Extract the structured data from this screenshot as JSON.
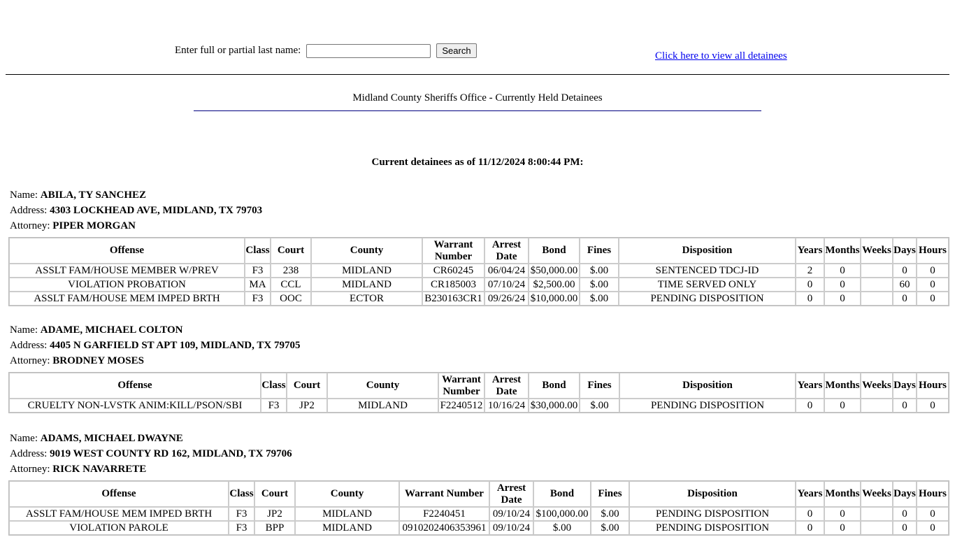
{
  "search": {
    "label": "Enter full or partial last name:",
    "value": "",
    "button": "Search"
  },
  "all_link": "Click here to view all detainees",
  "title": "Midland County Sheriffs Office - Currently Held Detainees",
  "as_of": "Current detainees as of 11/12/2024 8:00:44 PM:",
  "labels": {
    "name": "Name:",
    "address": "Address:",
    "attorney": "Attorney:"
  },
  "columns": [
    "Offense",
    "Class",
    "Court",
    "County",
    "Warrant Number",
    "Arrest Date",
    "Bond",
    "Fines",
    "Disposition",
    "Years",
    "Months",
    "Weeks",
    "Days",
    "Hours"
  ],
  "detainees": [
    {
      "name": "ABILA, TY SANCHEZ",
      "address": "4303 LOCKHEAD AVE, MIDLAND, TX 79703",
      "attorney": "PIPER MORGAN",
      "rows": [
        [
          "ASSLT FAM/HOUSE MEMBER W/PREV",
          "F3",
          "238",
          "MIDLAND",
          "CR60245",
          "06/04/24",
          "$50,000.00",
          "$.00",
          "SENTENCED TDCJ-ID",
          "2",
          "0",
          "",
          "0",
          "0"
        ],
        [
          "VIOLATION PROBATION",
          "MA",
          "CCL",
          "MIDLAND",
          "CR185003",
          "07/10/24",
          "$2,500.00",
          "$.00",
          "TIME SERVED ONLY",
          "0",
          "0",
          "",
          "60",
          "0"
        ],
        [
          "ASSLT FAM/HOUSE MEM IMPED BRTH",
          "F3",
          "OOC",
          "ECTOR",
          "B230163CR1",
          "09/26/24",
          "$10,000.00",
          "$.00",
          "PENDING DISPOSITION",
          "0",
          "0",
          "",
          "0",
          "0"
        ]
      ]
    },
    {
      "name": "ADAME, MICHAEL COLTON",
      "address": "4405 N GARFIELD ST APT 109, MIDLAND, TX 79705",
      "attorney": "BRODNEY MOSES",
      "rows": [
        [
          "CRUELTY NON-LVSTK ANIM:KILL/PSON/SBI",
          "F3",
          "JP2",
          "MIDLAND",
          "F2240512",
          "10/16/24",
          "$30,000.00",
          "$.00",
          "PENDING DISPOSITION",
          "0",
          "0",
          "",
          "0",
          "0"
        ]
      ]
    },
    {
      "name": "ADAMS, MICHAEL DWAYNE",
      "address": "9019 WEST COUNTY RD 162, MIDLAND, TX 79706",
      "attorney": "RICK NAVARRETE",
      "rows": [
        [
          "ASSLT FAM/HOUSE MEM IMPED BRTH",
          "F3",
          "JP2",
          "MIDLAND",
          "F2240451",
          "09/10/24",
          "$100,000.00",
          "$.00",
          "PENDING DISPOSITION",
          "0",
          "0",
          "",
          "0",
          "0"
        ],
        [
          "VIOLATION PAROLE",
          "F3",
          "BPP",
          "MIDLAND",
          "0910202406353961",
          "09/10/24",
          "$.00",
          "$.00",
          "PENDING DISPOSITION",
          "0",
          "0",
          "",
          "0",
          "0"
        ]
      ]
    }
  ]
}
